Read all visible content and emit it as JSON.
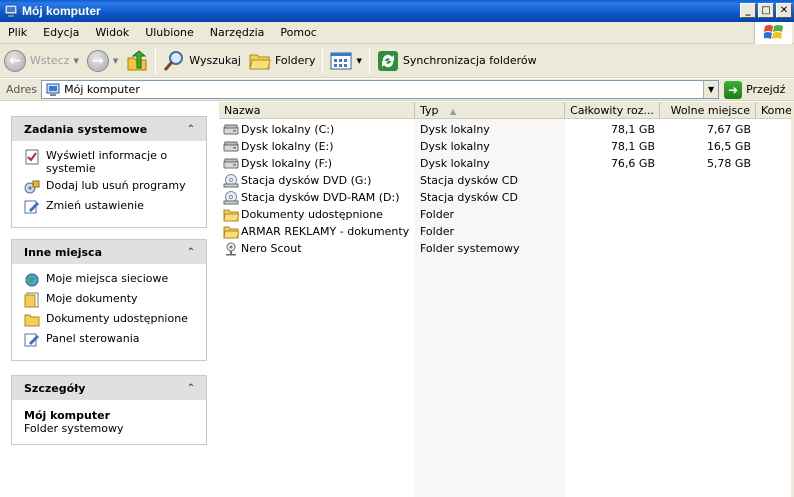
{
  "window": {
    "title": "Mój komputer",
    "buttons": [
      "_",
      "□",
      "✕"
    ]
  },
  "menu": [
    "Plik",
    "Edycja",
    "Widok",
    "Ulubione",
    "Narzędzia",
    "Pomoc"
  ],
  "toolbar": {
    "back_label": "Wstecz",
    "search_label": "Wyszukaj",
    "folders_label": "Foldery",
    "sync_label": "Synchronizacja folderów"
  },
  "address": {
    "label": "Adres",
    "value": "Mój komputer",
    "go_label": "Przejdź"
  },
  "left": {
    "system_tasks": {
      "title": "Zadania systemowe",
      "items": [
        "Wyświetl informacje o systemie",
        "Dodaj lub usuń programy",
        "Zmień ustawienie"
      ]
    },
    "other_places": {
      "title": "Inne miejsca",
      "items": [
        "Moje miejsca sieciowe",
        "Moje dokumenty",
        "Dokumenty udostępnione",
        "Panel sterowania"
      ]
    },
    "details": {
      "title": "Szczegóły",
      "name": "Mój komputer",
      "type": "Folder systemowy"
    }
  },
  "columns": [
    "Nazwa",
    "Typ",
    "Całkowity roz...",
    "Wolne miejsce",
    "Komen"
  ],
  "rows": [
    {
      "name": "Dysk lokalny (C:)",
      "type": "Dysk lokalny",
      "total": "78,1 GB",
      "free": "7,67 GB",
      "icon": "hard-drive-icon"
    },
    {
      "name": "Dysk lokalny (E:)",
      "type": "Dysk lokalny",
      "total": "78,1 GB",
      "free": "16,5 GB",
      "icon": "hard-drive-icon"
    },
    {
      "name": "Dysk lokalny (F:)",
      "type": "Dysk lokalny",
      "total": "76,6 GB",
      "free": "5,78 GB",
      "icon": "hard-drive-icon"
    },
    {
      "name": "Stacja dysków DVD (G:)",
      "type": "Stacja dysków CD",
      "total": "",
      "free": "",
      "icon": "dvd-drive-icon"
    },
    {
      "name": "Stacja dysków DVD-RAM (D:)",
      "type": "Stacja dysków CD",
      "total": "",
      "free": "",
      "icon": "dvd-drive-icon"
    },
    {
      "name": "Dokumenty udostępnione",
      "type": "Folder",
      "total": "",
      "free": "",
      "icon": "folder-icon"
    },
    {
      "name": "ARMAR REKLAMY - dokumenty",
      "type": "Folder",
      "total": "",
      "free": "",
      "icon": "folder-icon"
    },
    {
      "name": "Nero Scout",
      "type": "Folder systemowy",
      "total": "",
      "free": "",
      "icon": "network-folder-icon"
    }
  ]
}
